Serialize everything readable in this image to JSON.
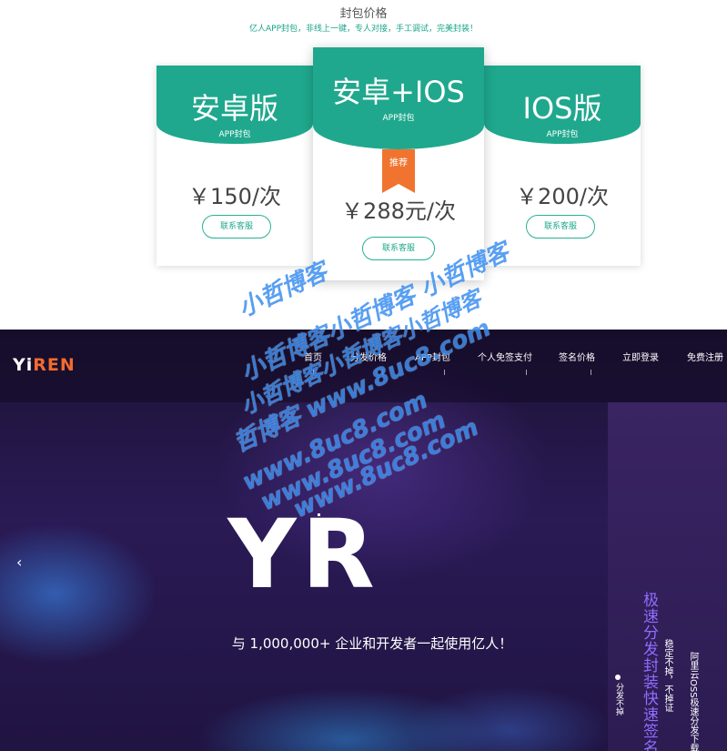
{
  "pricing": {
    "title": "封包价格",
    "subtitle": "亿人APP封包，非线上一键，专人对接，手工调试，完美封装！",
    "cards": [
      {
        "name": "安卓版",
        "sub": "APP封包",
        "price": "￥150/次",
        "button": "联系客服"
      },
      {
        "name": "安卓+IOS",
        "sub": "APP封包",
        "badge": "推荐",
        "price": "￥288元/次",
        "button": "联系客服"
      },
      {
        "name": "IOS版",
        "sub": "APP封包",
        "price": "￥200/次",
        "button": "联系客服"
      }
    ]
  },
  "nav": {
    "logo_part1": "Yi",
    "logo_part2": "REN",
    "items": [
      "首页",
      "分发价格",
      "APP封包",
      "个人免签支付",
      "签名价格",
      "立即登录",
      "免费注册"
    ]
  },
  "hero": {
    "prev_arrow": "‹",
    "brand": "YR",
    "tagline": "与 1,000,000+ 企业和开发者一起使用亿人！",
    "side_headline": "极速分发封装快速签名",
    "side_line1": "稳定不掉，不掉证",
    "side_line2": "阿里云OSS极速分发下载",
    "side_line3": "分发不掉"
  },
  "watermark": {
    "lines": [
      "小哲博客",
      "小哲博客小哲博客 小哲博客",
      "小哲博客小哲博客小哲博客",
      "哲博客 www.8uc8.com",
      "www.8uc8.com",
      "www.8uc8.com",
      "www.8uc8.com"
    ]
  },
  "colors": {
    "teal": "#1fa88d",
    "orange": "#f0742f",
    "hero_bg": "#2a1a55",
    "side_accent": "#8f6dff",
    "watermark": "#3d8ff0"
  },
  "icons": {
    "prev_arrow": "chevron-left-icon"
  }
}
